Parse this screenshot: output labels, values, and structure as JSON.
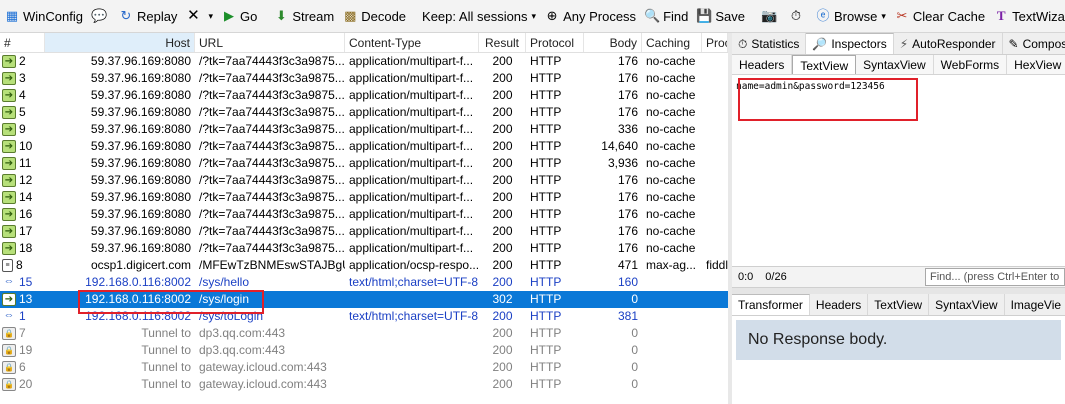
{
  "toolbar": {
    "winconfig": "WinConfig",
    "replay": "Replay",
    "go": "Go",
    "stream": "Stream",
    "decode": "Decode",
    "keep": "Keep: All sessions",
    "any_process": "Any Process",
    "find": "Find",
    "save": "Save",
    "browse": "Browse",
    "clear_cache": "Clear Cache",
    "textwizard": "TextWizard"
  },
  "grid": {
    "headers": [
      "#",
      "Host",
      "URL",
      "Content-Type",
      "Result",
      "Protocol",
      "Body",
      "Caching",
      "Proce"
    ],
    "rows": [
      {
        "num": "2",
        "icon": "green-arrow-icon",
        "host": "59.37.96.169:8080",
        "url": "/?tk=7aa74443f3c3a9875...",
        "ct": "application/multipart-f...",
        "result": "200",
        "protocol": "HTTP",
        "body": "176",
        "caching": "no-cache",
        "process": "",
        "style": "normal"
      },
      {
        "num": "3",
        "icon": "green-arrow-icon",
        "host": "59.37.96.169:8080",
        "url": "/?tk=7aa74443f3c3a9875...",
        "ct": "application/multipart-f...",
        "result": "200",
        "protocol": "HTTP",
        "body": "176",
        "caching": "no-cache",
        "process": "",
        "style": "normal"
      },
      {
        "num": "4",
        "icon": "green-arrow-icon",
        "host": "59.37.96.169:8080",
        "url": "/?tk=7aa74443f3c3a9875...",
        "ct": "application/multipart-f...",
        "result": "200",
        "protocol": "HTTP",
        "body": "176",
        "caching": "no-cache",
        "process": "",
        "style": "normal"
      },
      {
        "num": "5",
        "icon": "green-arrow-icon",
        "host": "59.37.96.169:8080",
        "url": "/?tk=7aa74443f3c3a9875...",
        "ct": "application/multipart-f...",
        "result": "200",
        "protocol": "HTTP",
        "body": "176",
        "caching": "no-cache",
        "process": "",
        "style": "normal"
      },
      {
        "num": "9",
        "icon": "green-arrow-icon",
        "host": "59.37.96.169:8080",
        "url": "/?tk=7aa74443f3c3a9875...",
        "ct": "application/multipart-f...",
        "result": "200",
        "protocol": "HTTP",
        "body": "336",
        "caching": "no-cache",
        "process": "",
        "style": "normal"
      },
      {
        "num": "10",
        "icon": "green-arrow-icon",
        "host": "59.37.96.169:8080",
        "url": "/?tk=7aa74443f3c3a9875...",
        "ct": "application/multipart-f...",
        "result": "200",
        "protocol": "HTTP",
        "body": "14,640",
        "caching": "no-cache",
        "process": "",
        "style": "normal"
      },
      {
        "num": "11",
        "icon": "green-arrow-icon",
        "host": "59.37.96.169:8080",
        "url": "/?tk=7aa74443f3c3a9875...",
        "ct": "application/multipart-f...",
        "result": "200",
        "protocol": "HTTP",
        "body": "3,936",
        "caching": "no-cache",
        "process": "",
        "style": "normal"
      },
      {
        "num": "12",
        "icon": "green-arrow-icon",
        "host": "59.37.96.169:8080",
        "url": "/?tk=7aa74443f3c3a9875...",
        "ct": "application/multipart-f...",
        "result": "200",
        "protocol": "HTTP",
        "body": "176",
        "caching": "no-cache",
        "process": "",
        "style": "normal"
      },
      {
        "num": "14",
        "icon": "green-arrow-icon",
        "host": "59.37.96.169:8080",
        "url": "/?tk=7aa74443f3c3a9875...",
        "ct": "application/multipart-f...",
        "result": "200",
        "protocol": "HTTP",
        "body": "176",
        "caching": "no-cache",
        "process": "",
        "style": "normal"
      },
      {
        "num": "16",
        "icon": "green-arrow-icon",
        "host": "59.37.96.169:8080",
        "url": "/?tk=7aa74443f3c3a9875...",
        "ct": "application/multipart-f...",
        "result": "200",
        "protocol": "HTTP",
        "body": "176",
        "caching": "no-cache",
        "process": "",
        "style": "normal"
      },
      {
        "num": "17",
        "icon": "green-arrow-icon",
        "host": "59.37.96.169:8080",
        "url": "/?tk=7aa74443f3c3a9875...",
        "ct": "application/multipart-f...",
        "result": "200",
        "protocol": "HTTP",
        "body": "176",
        "caching": "no-cache",
        "process": "",
        "style": "normal"
      },
      {
        "num": "18",
        "icon": "green-arrow-icon",
        "host": "59.37.96.169:8080",
        "url": "/?tk=7aa74443f3c3a9875...",
        "ct": "application/multipart-f...",
        "result": "200",
        "protocol": "HTTP",
        "body": "176",
        "caching": "no-cache",
        "process": "",
        "style": "normal"
      },
      {
        "num": "8",
        "icon": "document-icon",
        "host": "ocsp1.digicert.com",
        "url": "/MFEwTzBNMEswSTAJBgU...",
        "ct": "application/ocsp-respo...",
        "result": "200",
        "protocol": "HTTP",
        "body": "471",
        "caching": "max-ag...",
        "process": "fiddle",
        "style": "normal"
      },
      {
        "num": "15",
        "icon": "blue-arrows-icon",
        "host": "192.168.0.116:8002",
        "url": "/sys/hello",
        "ct": "text/html;charset=UTF-8",
        "result": "200",
        "protocol": "HTTP",
        "body": "160",
        "caching": "",
        "process": "",
        "style": "blue"
      },
      {
        "num": "13",
        "icon": "green-arrow-icon",
        "host": "192.168.0.116:8002",
        "url": "/sys/login",
        "ct": "",
        "result": "302",
        "protocol": "HTTP",
        "body": "0",
        "caching": "",
        "process": "",
        "style": "selected"
      },
      {
        "num": "1",
        "icon": "blue-arrows-icon",
        "host": "192.168.0.116:8002",
        "url": "/sys/toLogin",
        "ct": "text/html;charset=UTF-8",
        "result": "200",
        "protocol": "HTTP",
        "body": "381",
        "caching": "",
        "process": "",
        "style": "blue"
      },
      {
        "num": "7",
        "icon": "lock-icon",
        "host": "Tunnel to",
        "url": "dp3.qq.com:443",
        "ct": "",
        "result": "200",
        "protocol": "HTTP",
        "body": "0",
        "caching": "",
        "process": "",
        "style": "gray"
      },
      {
        "num": "19",
        "icon": "lock-icon",
        "host": "Tunnel to",
        "url": "dp3.qq.com:443",
        "ct": "",
        "result": "200",
        "protocol": "HTTP",
        "body": "0",
        "caching": "",
        "process": "",
        "style": "gray"
      },
      {
        "num": "6",
        "icon": "lock-icon",
        "host": "Tunnel to",
        "url": "gateway.icloud.com:443",
        "ct": "",
        "result": "200",
        "protocol": "HTTP",
        "body": "0",
        "caching": "",
        "process": "",
        "style": "gray"
      },
      {
        "num": "20",
        "icon": "lock-icon",
        "host": "Tunnel to",
        "url": "gateway.icloud.com:443",
        "ct": "",
        "result": "200",
        "protocol": "HTTP",
        "body": "0",
        "caching": "",
        "process": "",
        "style": "gray"
      }
    ]
  },
  "inspector": {
    "top_tabs": [
      "Statistics",
      "Inspectors",
      "AutoResponder",
      "Compos"
    ],
    "request_tabs": [
      "Headers",
      "TextView",
      "SyntaxView",
      "WebForms",
      "HexView"
    ],
    "request_body": "name=admin&password=123456",
    "status_pos": "0:0",
    "status_len": "0/26",
    "find_placeholder": "Find... (press Ctrl+Enter to",
    "response_tabs": [
      "Transformer",
      "Headers",
      "TextView",
      "SyntaxView",
      "ImageVie"
    ],
    "no_response": "No Response body."
  },
  "colors": {
    "selected_row": "#0a78d7",
    "blue_text": "#1a3fc4",
    "highlight_box": "#e0202a"
  }
}
